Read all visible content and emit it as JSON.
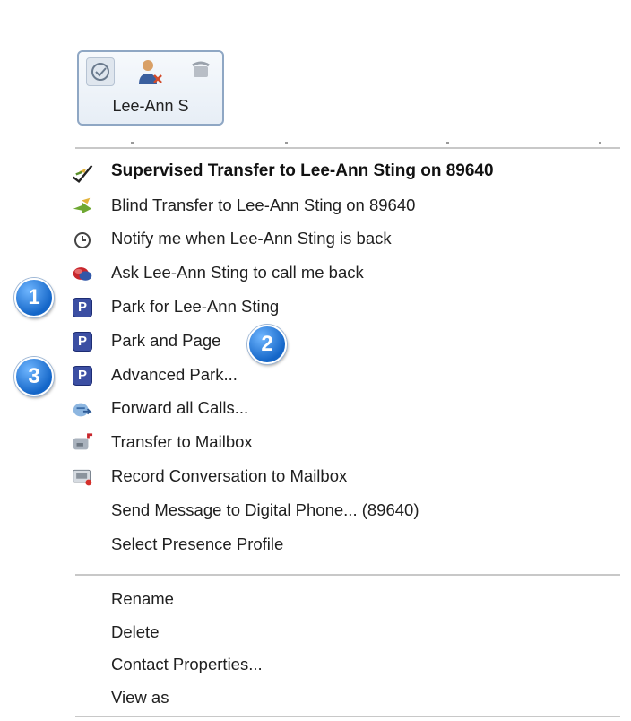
{
  "contact_card": {
    "name": "Lee-Ann S",
    "icons": [
      "presence-status-icon",
      "user-busy-icon",
      "phone-icon"
    ]
  },
  "menu": {
    "items": [
      {
        "label": "Supervised Transfer to Lee-Ann Sting on 89640",
        "icon": "supervised-transfer-icon",
        "bold": true
      },
      {
        "label": "Blind Transfer to Lee-Ann Sting on 89640",
        "icon": "blind-transfer-icon"
      },
      {
        "label": "Notify me when Lee-Ann Sting is back",
        "icon": "clock-icon"
      },
      {
        "label": "Ask Lee-Ann Sting to call me back",
        "icon": "callback-icon"
      },
      {
        "label": "Park for Lee-Ann Sting",
        "icon": "park-icon"
      },
      {
        "label": "Park and Page",
        "icon": "park-icon"
      },
      {
        "label": "Advanced Park...",
        "icon": "park-icon"
      },
      {
        "label": "Forward all Calls...",
        "icon": "forward-icon"
      },
      {
        "label": "Transfer to Mailbox",
        "icon": "mailbox-icon"
      },
      {
        "label": "Record Conversation to Mailbox",
        "icon": "record-icon"
      },
      {
        "label": "Send Message to Digital Phone... (89640)",
        "icon": ""
      },
      {
        "label": "Select Presence Profile",
        "icon": ""
      }
    ],
    "secondary": [
      {
        "label": "Rename"
      },
      {
        "label": "Delete"
      },
      {
        "label": "Contact Properties..."
      },
      {
        "label": "View as"
      }
    ]
  },
  "callouts": [
    "1",
    "2",
    "3"
  ],
  "colors": {
    "park_icon": "#3c4fa3",
    "callout": "#1466c8",
    "card_border": "#8fa7c4"
  }
}
